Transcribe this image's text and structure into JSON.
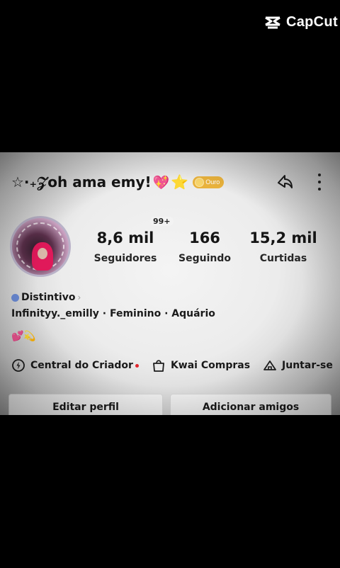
{
  "watermark": {
    "text": "CapCut"
  },
  "profile": {
    "username": "☆·₊𝒵oh ama emy!",
    "emoji_after_name": "💖",
    "star_emoji": "⭐",
    "badge": "Ouro",
    "notification_count": "99+",
    "stats": {
      "followers": {
        "value": "8,6 mil",
        "label": "Seguidores"
      },
      "following": {
        "value": "166",
        "label": "Seguindo"
      },
      "likes": {
        "value": "15,2 mil",
        "label": "Curtidas"
      }
    },
    "distintivo_label": "Distintivo",
    "distintivo_chevron": "›",
    "info_line": "Infinityy._emilly · Feminino · Aquário",
    "bio_emojis": "💕💫"
  },
  "links": {
    "creator_center": "Central do Criador",
    "kwai_shop": "Kwai Compras",
    "join": "Juntar-se"
  },
  "buttons": {
    "edit_profile": "Editar perfil",
    "add_friends": "Adicionar amigos"
  },
  "icons": [
    "capcut-logo-icon",
    "share-icon",
    "more-icon",
    "creator-center-icon",
    "shopping-bag-icon",
    "join-icon",
    "distintivo-icon"
  ]
}
